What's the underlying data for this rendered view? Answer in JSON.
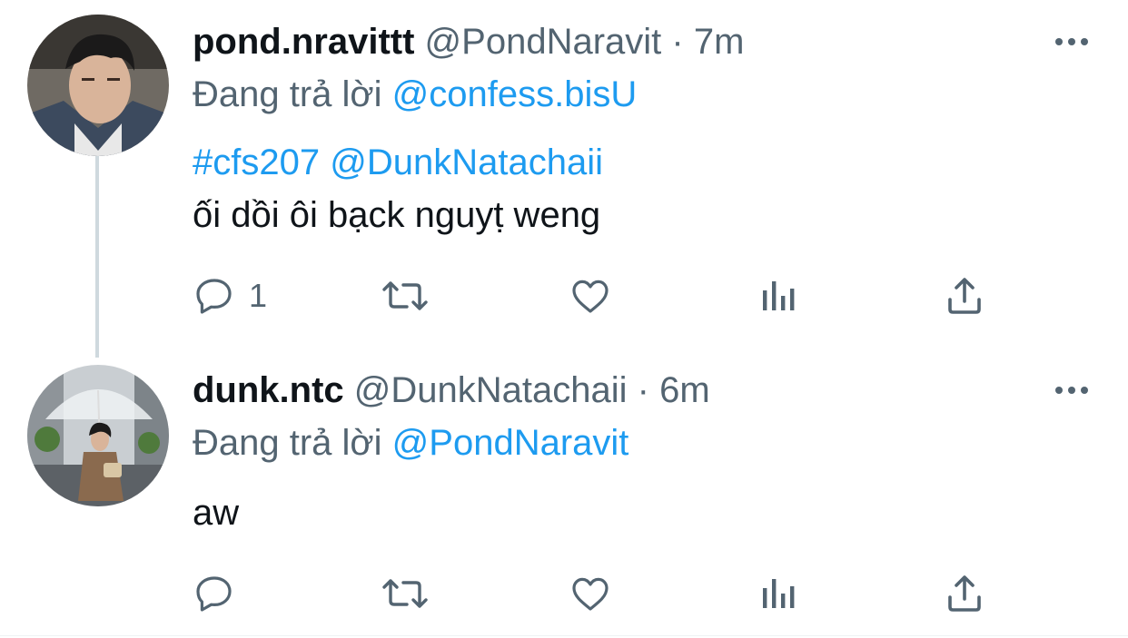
{
  "tweets": [
    {
      "display_name": "pond.nravittt",
      "handle": "@PondNaravit",
      "separator": "·",
      "time": "7m",
      "reply_prefix": "Đang trả lời",
      "reply_to": "@confess.bisU",
      "hashtag": "#cfs207",
      "mention": "@DunkNatachaii",
      "body": "ối dồi ôi bạck nguyṭ weng",
      "actions": {
        "reply_count": "1",
        "retweet_count": "",
        "like_count": ""
      },
      "icons": [
        "reply-icon",
        "retweet-icon",
        "like-icon",
        "analytics-icon",
        "share-icon",
        "more-icon"
      ]
    },
    {
      "display_name": "dunk.ntc",
      "handle": "@DunkNatachaii",
      "separator": "·",
      "time": "6m",
      "reply_prefix": "Đang trả lời",
      "reply_to": "@PondNaravit",
      "body": "aw",
      "actions": {
        "reply_count": "",
        "retweet_count": "",
        "like_count": ""
      },
      "icons": [
        "reply-icon",
        "retweet-icon",
        "like-icon",
        "analytics-icon",
        "share-icon",
        "more-icon"
      ]
    }
  ],
  "colors": {
    "link": "#1d9bf0",
    "secondary_text": "#536471",
    "primary_text": "#0f1419",
    "thread_line": "#cfd9de"
  }
}
